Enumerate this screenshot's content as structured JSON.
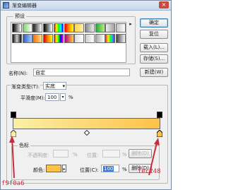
{
  "window": {
    "title": "渐变编辑器"
  },
  "presets": {
    "label": "预设",
    "swatches": [
      {
        "bg": "linear-gradient(90deg,#000,#fff)"
      },
      {
        "bg": "linear-gradient(90deg,#7fd36a,#fff)"
      },
      {
        "bg": "linear-gradient(90deg,#1d1d1d,#ffffff00)"
      },
      {
        "bg": "linear-gradient(90deg,#000,#fff)"
      },
      {
        "bg": "linear-gradient(90deg,#ff0000,#ffff00,#00ff00,#00ffff,#0000ff)"
      },
      {
        "bg": "linear-gradient(90deg,#ff0000,#ff9900,#ffff00)"
      },
      {
        "bg": "linear-gradient(90deg,#ffd35a,#fff0a8)"
      },
      {
        "bg": "linear-gradient(90deg,#888,#eee)"
      },
      {
        "bg": "linear-gradient(90deg,#2aa842,#b7f07a)"
      },
      {
        "bg": "linear-gradient(90deg,#eeeeee,#a0a0a0)"
      },
      {
        "bg": "linear-gradient(90deg,#c2c2c2,#ffffff)"
      },
      {
        "bg": "linear-gradient(90deg,#111,#ccc,#111)"
      },
      {
        "bg": "linear-gradient(90deg,#2a5fc8,#a9c8ff)"
      },
      {
        "bg": "linear-gradient(90deg,#ff6a00,#ffe08a)"
      },
      {
        "bg": "linear-gradient(90deg,#d50000,#ff8800,#ffff00)"
      },
      {
        "bg": "linear-gradient(90deg,#ff0000,#ffff00,#00ff00,#0000ff,#ff00ff)"
      },
      {
        "bg": "linear-gradient(90deg,#b1007a,#ffd23c)"
      },
      {
        "bg": "linear-gradient(90deg,#dcdcdc,#ffffff)"
      },
      {
        "bg": "linear-gradient(90deg,#ccc,#fff)"
      },
      {
        "bg": "linear-gradient(90deg,#aaaaaa,#ffffff)"
      },
      {
        "bg": "linear-gradient(90deg,#fd3d3d,#fff200,#2fff00,#00c8ff,#9d00ff)"
      },
      {
        "bg": "linear-gradient(90deg,#444,#f5f5f5)"
      }
    ]
  },
  "buttons": {
    "ok": "确定",
    "reset": "复位",
    "load": "载入(L)...",
    "save": "存储(S)..."
  },
  "name": {
    "label": "名称(N):",
    "value": "自定",
    "new_button": "新建(W)"
  },
  "gradient_type": {
    "label": "渐变类型(T):",
    "value": "实底"
  },
  "smoothness": {
    "label": "平滑度(M):",
    "value": "100",
    "unit": "%"
  },
  "gradient": {
    "from": "#f9f0a6",
    "to": "#fec248"
  },
  "color_stop": {
    "section_label": "色标",
    "opacity_label": "不透明度:",
    "opacity_unit": "%",
    "position_label": "位置:",
    "position_unit": "%",
    "delete_label": "删除(D)",
    "color_label": "颜色:",
    "color_swatch": "#fec248",
    "position2_label": "位置(C):",
    "position2_value": "100",
    "delete2_label": "删除(D)"
  },
  "annotations": {
    "left": "f9f0a6",
    "right": "fec248"
  }
}
